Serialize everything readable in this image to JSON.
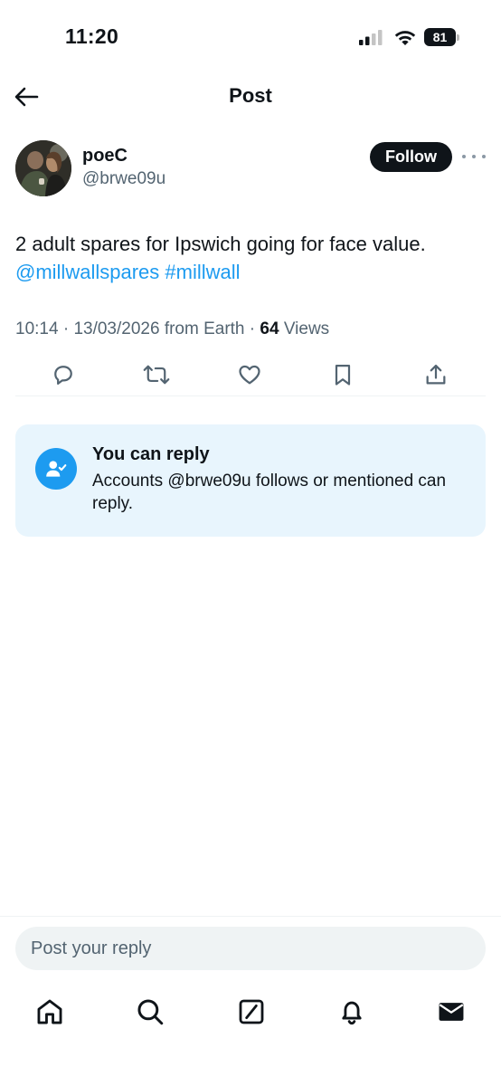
{
  "status_bar": {
    "time": "11:20",
    "battery": "81",
    "icons": [
      "signal-icon",
      "wifi-icon",
      "battery-icon"
    ]
  },
  "header": {
    "title": "Post",
    "back_icon": "back-arrow-icon"
  },
  "author": {
    "name": "poeC",
    "handle": "@brwe09u",
    "follow_label": "Follow",
    "more_icon": "more-options-icon"
  },
  "post": {
    "text": "2 adult spares for Ipswich going for face value.",
    "mention": "@millwallspares",
    "hashtag": "#millwall",
    "meta": {
      "time": "10:14",
      "date": "13/03/2026",
      "source": "from Earth",
      "views_count": "64",
      "views_label": "Views"
    }
  },
  "actions": [
    "reply-icon",
    "repost-icon",
    "like-icon",
    "bookmark-icon",
    "share-icon"
  ],
  "reply_restriction": {
    "title": "You can reply",
    "description": "Accounts @brwe09u follows or mentioned can reply.",
    "icon": "user-check-icon"
  },
  "composer": {
    "placeholder": "Post your reply"
  },
  "tab_bar": [
    "home-icon",
    "search-icon",
    "grok-icon",
    "notifications-icon",
    "messages-icon"
  ],
  "colors": {
    "accent": "#1d9bf0",
    "text": "#0f1419",
    "secondary_text": "#536471",
    "card_bg": "#e8f5fd"
  }
}
